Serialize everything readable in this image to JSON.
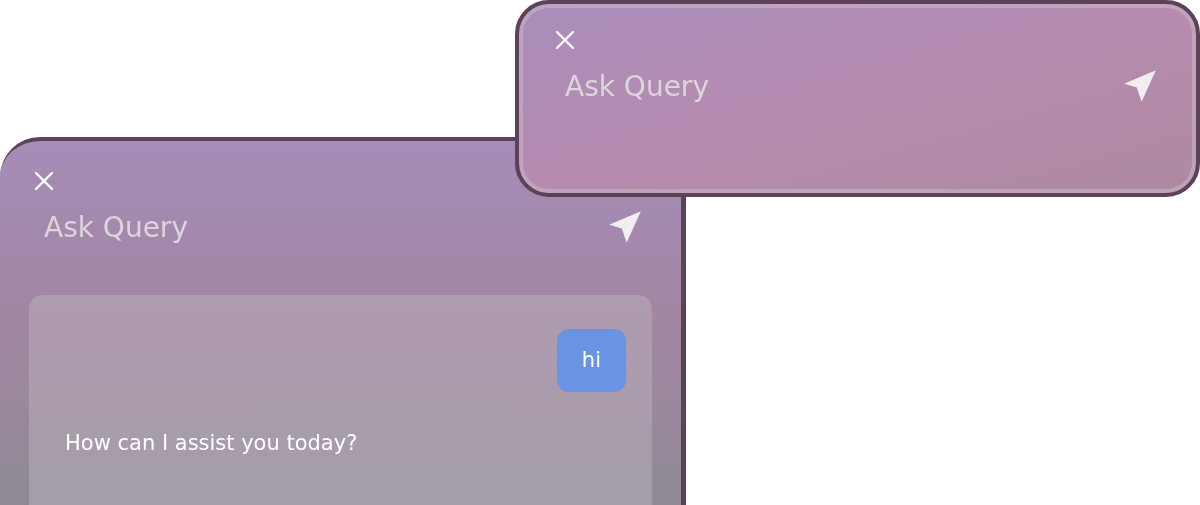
{
  "panels": [
    {
      "query_field": {
        "placeholder": "Ask Query"
      },
      "messages": [
        {
          "kind": "user",
          "text": "hi"
        },
        {
          "kind": "assistant",
          "text": "How can I assist you today?"
        }
      ]
    },
    {
      "query_field": {
        "placeholder": "Ask Query"
      }
    }
  ]
}
